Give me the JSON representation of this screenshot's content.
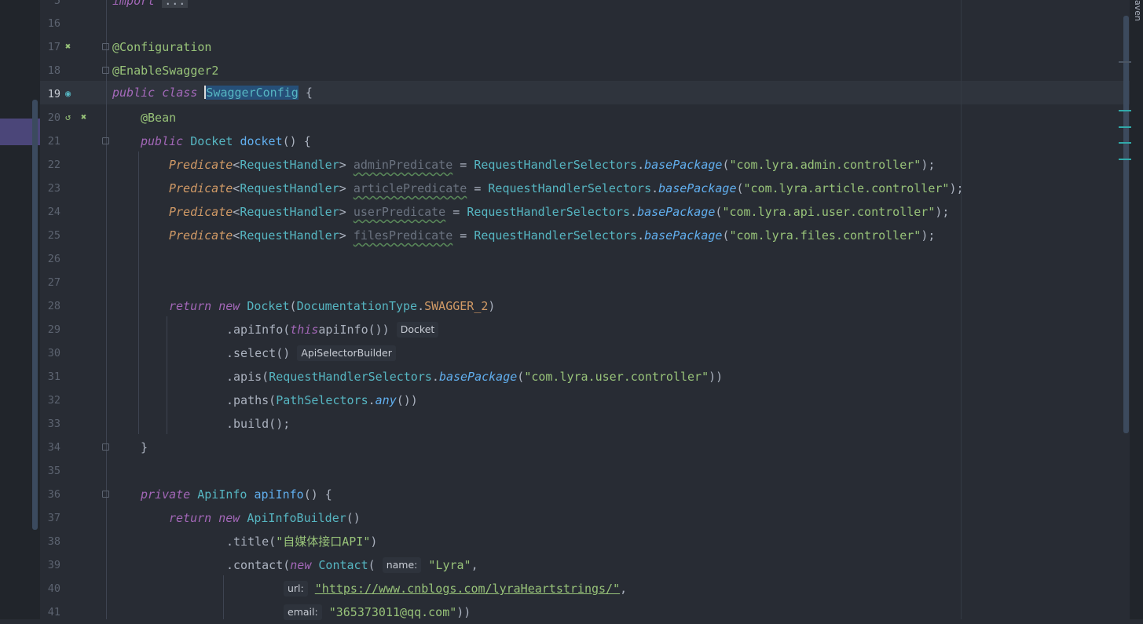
{
  "maven_tab": "aven",
  "gutter": {
    "line_numbers": [
      "16",
      "17",
      "18",
      "19",
      "20",
      "21",
      "22",
      "23",
      "24",
      "25",
      "26",
      "27",
      "28",
      "29",
      "30",
      "31",
      "32",
      "33",
      "34",
      "35",
      "36",
      "37",
      "38",
      "39",
      "40",
      "41"
    ],
    "current_line": "19"
  },
  "code": {
    "l15_import": "import",
    "l15_fold": "...",
    "l17": "@Configuration",
    "l18": "@EnableSwagger2",
    "l19": {
      "kw1": "public",
      "kw2": "class",
      "name": "SwaggerConfig",
      "rest": " {"
    },
    "l20": "@Bean",
    "l21": {
      "kw": "public",
      "type": "Docket",
      "name": "docket",
      "rest": "() {"
    },
    "predicates": [
      {
        "var": "adminPredicate",
        "pkg": "\"com.lyra.admin.controller\""
      },
      {
        "var": "articlePredicate",
        "pkg": "\"com.lyra.article.controller\""
      },
      {
        "var": "userPredicate",
        "pkg": "\"com.lyra.api.user.controller\""
      },
      {
        "var": "filesPredicate",
        "pkg": "\"com.lyra.files.controller\""
      }
    ],
    "pred_type": "Predicate",
    "pred_generic": "RequestHandler",
    "selectors": "RequestHandlerSelectors",
    "base_package": "basePackage",
    "l28": {
      "kw1": "return",
      "kw2": "new",
      "type": "Docket",
      "arg_type": "DocumentationType",
      "const": "SWAGGER_2"
    },
    "l29": {
      "pre": ".apiInfo(",
      "this": "this",
      ".": ".",
      "call": "apiInfo",
      "post": "())",
      "hint": "Docket"
    },
    "l30": {
      "call": ".select()",
      "hint": "ApiSelectorBuilder"
    },
    "l31": {
      "pre": ".apis(",
      "pkg": "\"com.lyra.user.controller\"",
      "post": "))"
    },
    "l32": {
      "pre": ".paths(",
      "cls": "PathSelectors",
      "m": "any",
      "post": "())"
    },
    "l33": ".build();",
    "l34": "}",
    "l36": {
      "kw": "private",
      "type": "ApiInfo",
      "name": "apiInfo",
      "rest": "() {"
    },
    "l37": {
      "kw1": "return",
      "kw2": "new",
      "type": "ApiInfoBuilder",
      "rest": "()"
    },
    "l38": {
      "pre": ".title(",
      "str": "\"自媒体接口API\"",
      "post": ")"
    },
    "l39": {
      "pre": ".contact(",
      "kw": "new",
      "type": "Contact",
      "paren": "(",
      "hint": "name:",
      "str": "\"Lyra\"",
      "post": ","
    },
    "l40": {
      "hint": "url:",
      "str": "\"https://www.cnblogs.com/lyraHeartstrings/\"",
      "post": ","
    },
    "l41": {
      "hint": "email:",
      "str": "\"365373011@qq.com\"",
      "post": "))"
    }
  }
}
